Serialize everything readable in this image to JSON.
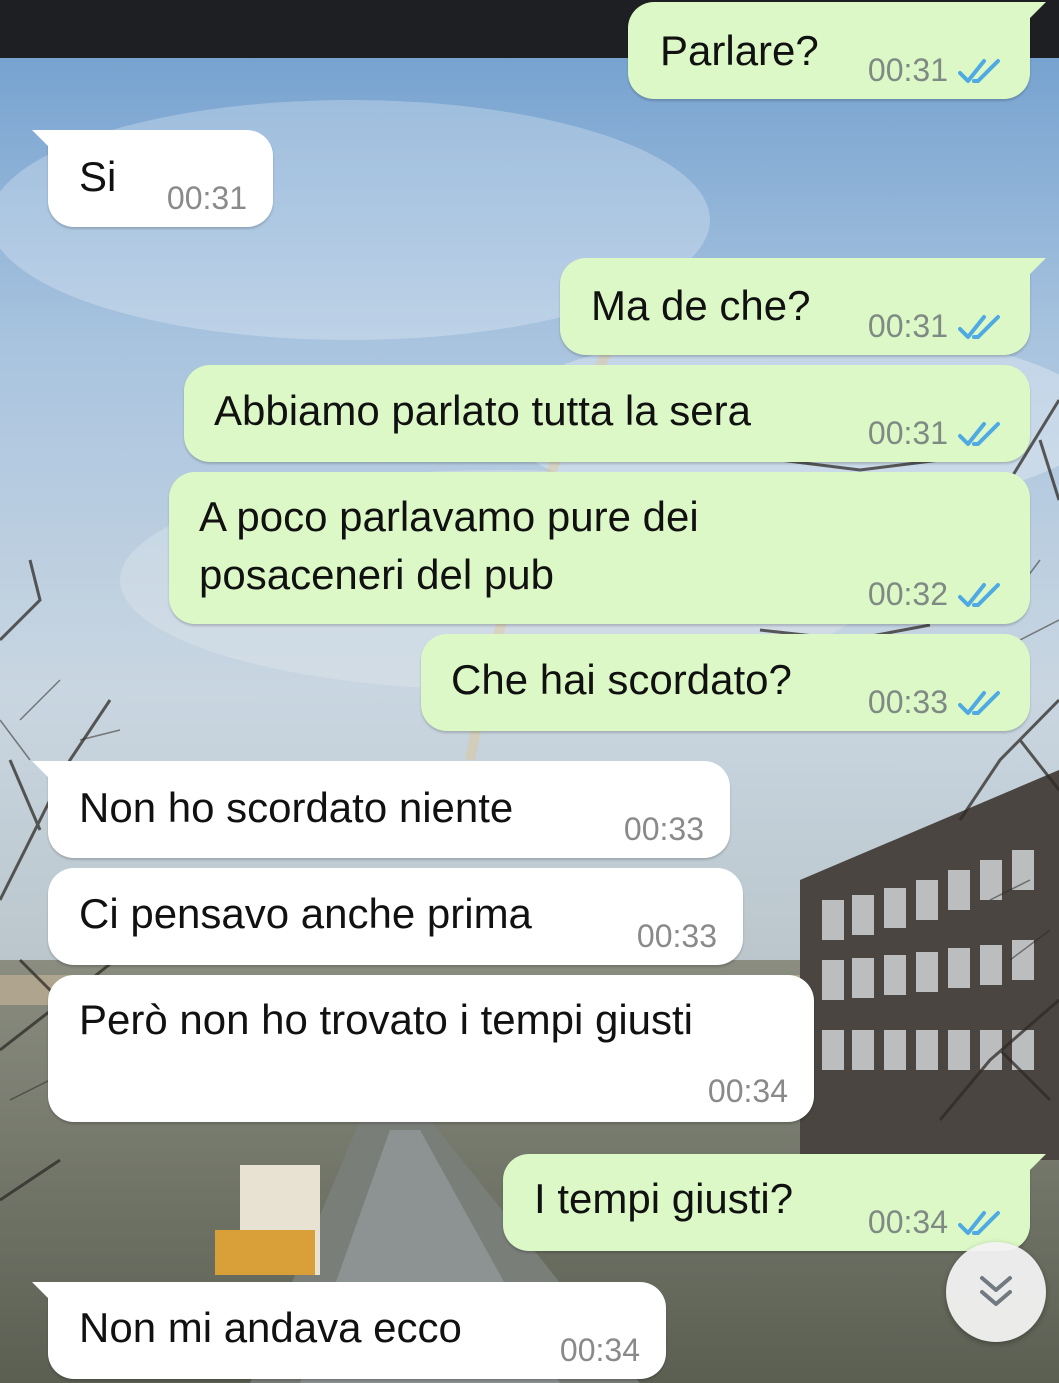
{
  "colors": {
    "outgoing_bubble": "#dcf8c6",
    "incoming_bubble": "#ffffff",
    "read_ticks": "#4fa9e3",
    "time_text": "#7f8a84"
  },
  "icons": {
    "read_receipt": "double-check-icon",
    "scroll_down": "double-chevron-down-icon"
  },
  "messages": [
    {
      "direction": "out",
      "text": "Parlare?",
      "time": "00:31",
      "read": true
    },
    {
      "direction": "in",
      "text": "Si",
      "time": "00:31"
    },
    {
      "direction": "out",
      "text": "Ma de che?",
      "time": "00:31",
      "read": true
    },
    {
      "direction": "out",
      "text": "Abbiamo parlato tutta la sera",
      "time": "00:31",
      "read": true
    },
    {
      "direction": "out",
      "text": "A poco parlavamo pure dei\nposaceneri del pub",
      "time": "00:32",
      "read": true
    },
    {
      "direction": "out",
      "text": "Che hai scordato?",
      "time": "00:33",
      "read": true
    },
    {
      "direction": "in",
      "text": "Non ho scordato niente",
      "time": "00:33"
    },
    {
      "direction": "in",
      "text": "Ci pensavo anche prima",
      "time": "00:33"
    },
    {
      "direction": "in",
      "text": "Però non ho trovato i tempi giusti",
      "time": "00:34"
    },
    {
      "direction": "out",
      "text": "I tempi giusti?",
      "time": "00:34",
      "read": true
    },
    {
      "direction": "in",
      "text": "Non mi andava ecco",
      "time": "00:34"
    }
  ]
}
